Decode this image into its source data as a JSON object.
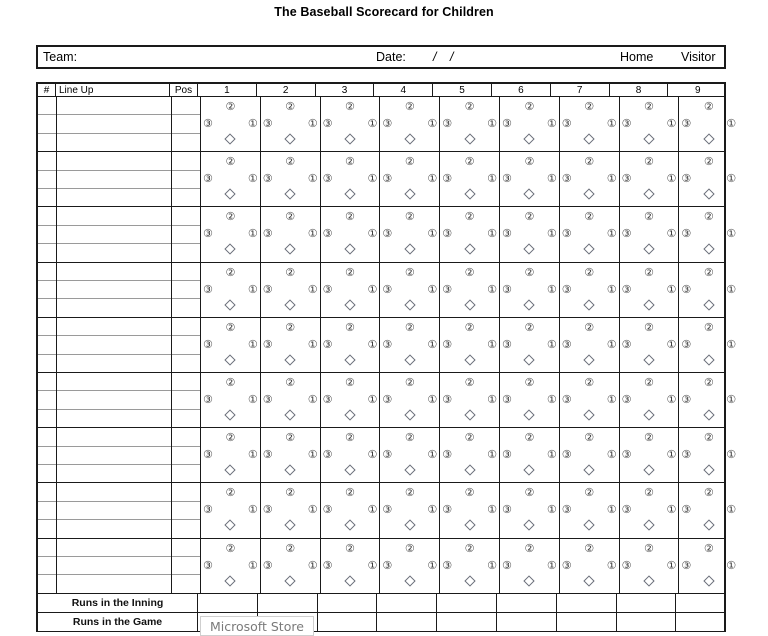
{
  "document": {
    "title": "The Baseball Scorecard for Children"
  },
  "info_bar": {
    "team_label": "Team:",
    "team_value": "",
    "date_label": "Date:",
    "date_slash_1": "/",
    "date_slash_2": "/",
    "date_month": "",
    "date_day": "",
    "date_year": "",
    "home_label": "Home",
    "visitor_label": "Visitor"
  },
  "table": {
    "headers": {
      "number": "#",
      "lineup": "Line Up",
      "position": "Pos",
      "innings": [
        "1",
        "2",
        "3",
        "4",
        "5",
        "6",
        "7",
        "8",
        "9"
      ]
    },
    "bases": {
      "second": "②",
      "third": "③",
      "first": "①",
      "home": "home-plate-diamond"
    },
    "player_rows": [
      {
        "number": "",
        "lineup": "",
        "position": ""
      },
      {
        "number": "",
        "lineup": "",
        "position": ""
      },
      {
        "number": "",
        "lineup": "",
        "position": ""
      },
      {
        "number": "",
        "lineup": "",
        "position": ""
      },
      {
        "number": "",
        "lineup": "",
        "position": ""
      },
      {
        "number": "",
        "lineup": "",
        "position": ""
      },
      {
        "number": "",
        "lineup": "",
        "position": ""
      },
      {
        "number": "",
        "lineup": "",
        "position": ""
      },
      {
        "number": "",
        "lineup": "",
        "position": ""
      }
    ],
    "totals": [
      {
        "label": "Runs in the Inning",
        "values": [
          "",
          "",
          "",
          "",
          "",
          "",
          "",
          "",
          ""
        ]
      },
      {
        "label": "Runs in the Game",
        "values": [
          "",
          "",
          "",
          "",
          "",
          "",
          "",
          "",
          ""
        ]
      }
    ]
  },
  "overlay": {
    "tooltip_text": "Microsoft Store"
  },
  "colors": {
    "border_strong": "#1a1a1a",
    "border_light": "#9a9a9a",
    "base_glyph": "#3a3a3a",
    "diamond_outline": "#6b6f7a",
    "tooltip_text": "#7a7a7a",
    "tooltip_border": "#cfcfcf"
  }
}
